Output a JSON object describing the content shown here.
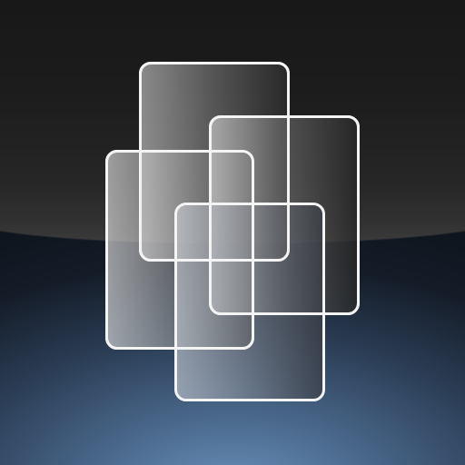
{
  "app_icon": {
    "name": "overlapping-windows-app-icon",
    "tile_count": 4,
    "colors": {
      "top_background": "#1c1c1c",
      "bottom_glow": "#6f96c2",
      "tile_outline": "#f4f4f4"
    }
  }
}
